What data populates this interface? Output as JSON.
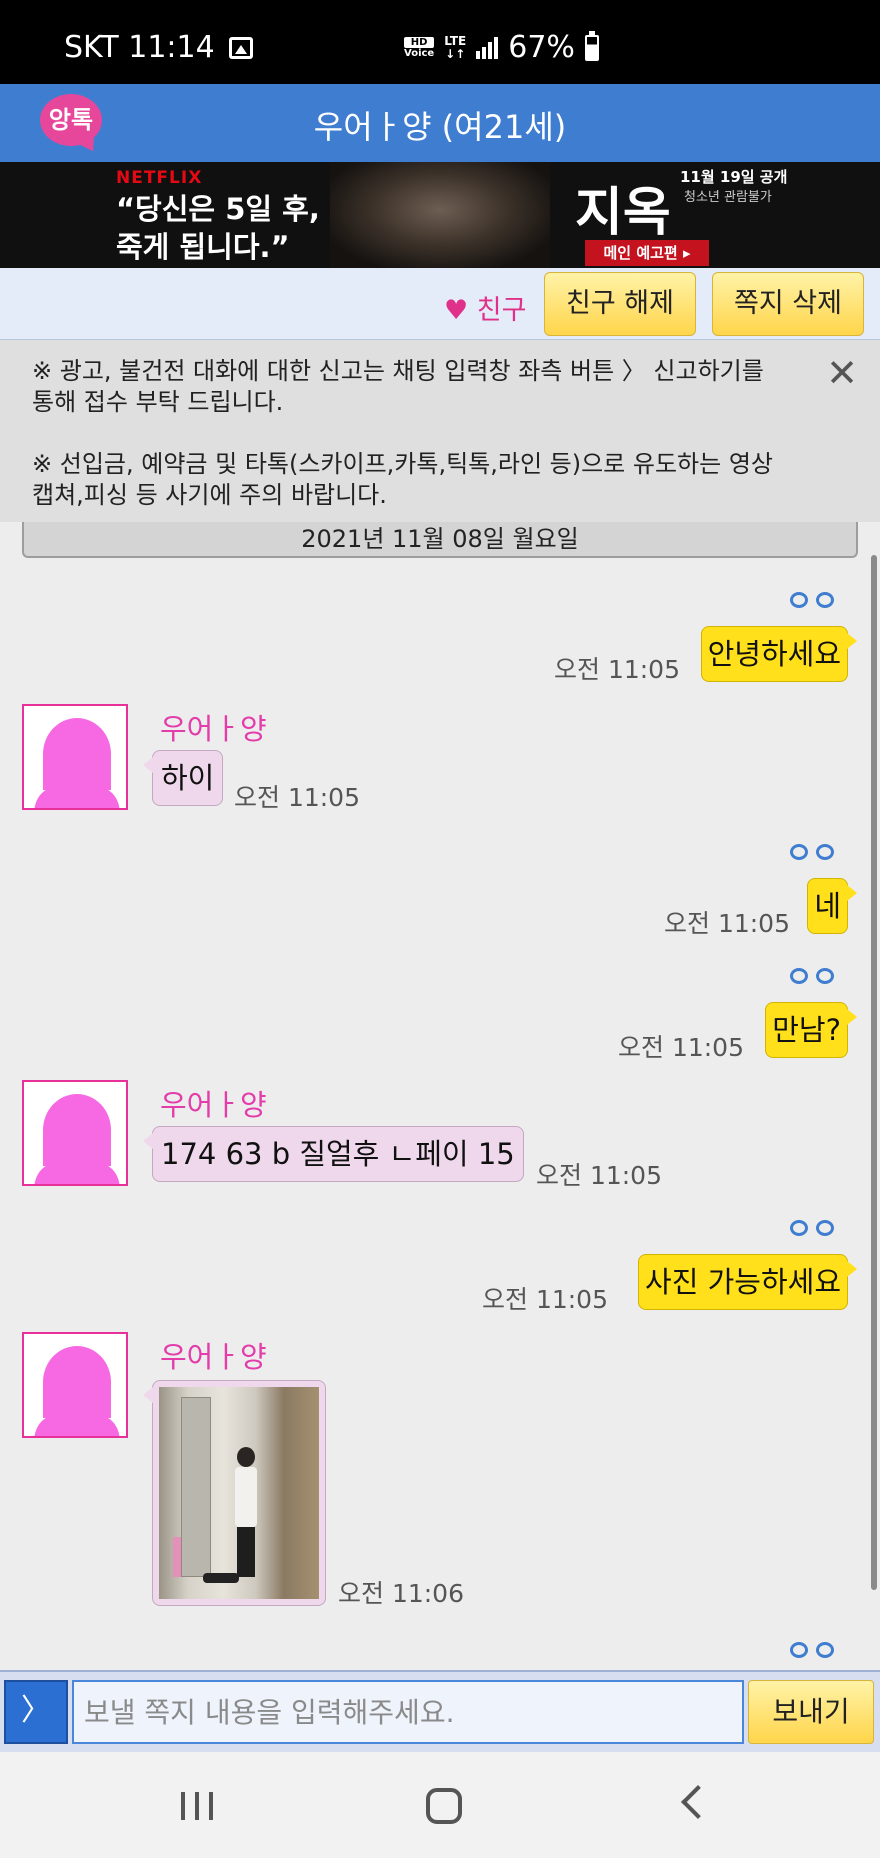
{
  "status_bar": {
    "carrier_time": "SKT 11:14",
    "hd_label": "HD",
    "voice_label": "Voice",
    "lte_label": "LTE",
    "battery": "67%"
  },
  "header": {
    "logo_text": "앙톡",
    "title": "우어ㅏ양 (여21세)"
  },
  "banner": {
    "netflix": "NETFLIX",
    "quote_line1": "“당신은 5일 후,",
    "quote_line2": "죽게 됩니다.”",
    "title": "지옥",
    "date": "11월 19일 공개",
    "rating": "청소년 관람불가",
    "cta": "메인 예고편 ▸"
  },
  "friend_bar": {
    "status": "♥ 친구",
    "unfriend": "친구 해제",
    "delete_msg": "쪽지 삭제"
  },
  "notice": {
    "line1": "※ 광고, 불건전 대화에 대한 신고는 채팅 입력창 좌측 버튼 〉 신고하기를 통해 접수 부탁 드립니다.",
    "line2": "※ 선입금, 예약금 및 타톡(스카이프,카톡,틱톡,라인 등)으로 유도하는 영상캡쳐,피싱 등 사기에 주의 바랍니다.",
    "close": "✕"
  },
  "date_divider": "2021년 11월 08일 월요일",
  "sender_name": "우어ㅏ양",
  "messages": [
    {
      "from": "me",
      "text": "안녕하세요",
      "time": "오전 11:05"
    },
    {
      "from": "them",
      "text": "하이",
      "time": "오전 11:05"
    },
    {
      "from": "me",
      "text": "네",
      "time": "오전 11:05"
    },
    {
      "from": "me",
      "text": "만남?",
      "time": "오전 11:05"
    },
    {
      "from": "them",
      "text": "174 63 b 질얼후 ㄴ페이 15",
      "time": "오전 11:05"
    },
    {
      "from": "me",
      "text": "사진 가능하세요",
      "time": "오전 11:05"
    },
    {
      "from": "them",
      "type": "photo",
      "time": "오전 11:06"
    }
  ],
  "input": {
    "report_button": "〉",
    "placeholder": "보낼 쪽지 내용을 입력해주세요.",
    "send": "보내기"
  },
  "colors": {
    "header": "#3f7dd1",
    "my_bubble": "#ffe01b",
    "their_bubble": "#efd8ec",
    "accent_pink": "#e33dab"
  }
}
